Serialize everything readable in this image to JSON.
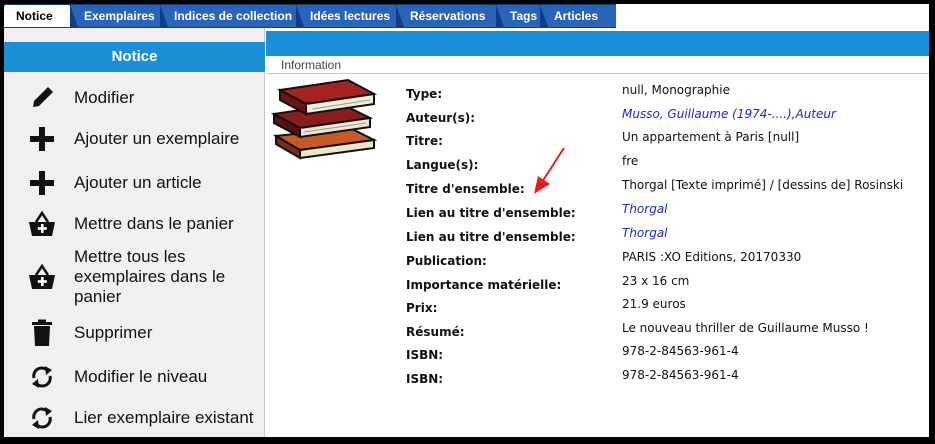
{
  "tabs": [
    {
      "label": "Notice",
      "active": true
    },
    {
      "label": "Exemplaires",
      "active": false
    },
    {
      "label": "Indices de collection",
      "active": false
    },
    {
      "label": "Idées lectures",
      "active": false
    },
    {
      "label": "Réservations",
      "active": false
    },
    {
      "label": "Tags",
      "active": false
    },
    {
      "label": "Articles",
      "active": false
    }
  ],
  "sidebar": {
    "title": "Notice",
    "items": [
      {
        "label": "Modifier",
        "icon": "pencil-icon"
      },
      {
        "label": "Ajouter un exemplaire",
        "icon": "plus-icon"
      },
      {
        "label": "Ajouter un article",
        "icon": "plus-icon"
      },
      {
        "label": "Mettre dans le panier",
        "icon": "basket-add-icon"
      },
      {
        "label": "Mettre tous les exemplaires dans le panier",
        "icon": "basket-add-icon"
      },
      {
        "label": "Supprimer",
        "icon": "trash-icon"
      },
      {
        "label": "Modifier le niveau",
        "icon": "refresh-icon"
      },
      {
        "label": "Lier exemplaire existant",
        "icon": "refresh-icon"
      }
    ]
  },
  "main": {
    "section_label": "Information",
    "image_icon": "books-icon",
    "fields": [
      {
        "label": "Type:",
        "value": "null, Monographie",
        "link": false
      },
      {
        "label": "Auteur(s):",
        "value": "Musso, Guillaume (1974-....),Auteur",
        "link": true
      },
      {
        "label": "Titre:",
        "value": "Un appartement à Paris [null]",
        "link": false
      },
      {
        "label": "Langue(s):",
        "value": "fre",
        "link": false
      },
      {
        "label": "Titre d'ensemble:",
        "value": "Thorgal [Texte imprimé] / [dessins de] Rosinski",
        "link": false
      },
      {
        "label": "Lien au titre d'ensemble:",
        "value": "Thorgal",
        "link": true
      },
      {
        "label": "Lien au titre d'ensemble:",
        "value": "Thorgal",
        "link": true
      },
      {
        "label": "Publication:",
        "value": "PARIS :XO Editions, 20170330",
        "link": false
      },
      {
        "label": "Importance matérielle:",
        "value": "23 x 16 cm",
        "link": false
      },
      {
        "label": "Prix:",
        "value": "21.9 euros",
        "link": false
      },
      {
        "label": "Résumé:",
        "value": "Le nouveau thriller de Guillaume Musso !",
        "link": false
      },
      {
        "label": "ISBN:",
        "value": "978-2-84563-961-4",
        "link": false
      },
      {
        "label": "ISBN:",
        "value": "978-2-84563-961-4",
        "link": false
      }
    ]
  },
  "colors": {
    "tab_strip": "#0e3d8a",
    "tab": "#2a64b8",
    "accent": "#1c8fd6",
    "link": "#1a2bcc",
    "annotation": "#e02020"
  }
}
